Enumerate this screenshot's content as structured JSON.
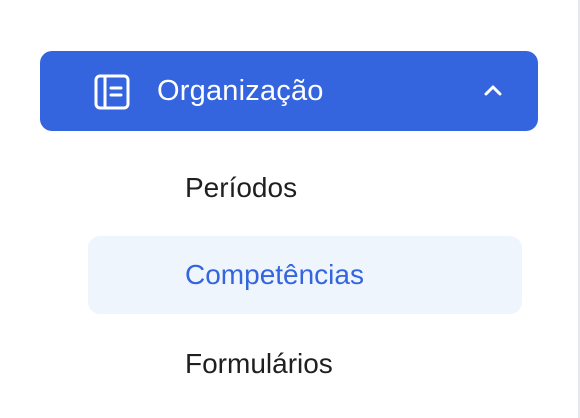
{
  "colors": {
    "accent": "#3565de",
    "active_bg": "#eef5fd",
    "text": "#1f1f1f",
    "header_text": "#ffffff"
  },
  "group": {
    "label": "Organização",
    "icon": "book-icon",
    "expanded": true,
    "toggle_icon": "chevron-up-icon"
  },
  "items": [
    {
      "label": "Períodos",
      "active": false
    },
    {
      "label": "Competências",
      "active": true
    },
    {
      "label": "Formulários",
      "active": false
    }
  ]
}
